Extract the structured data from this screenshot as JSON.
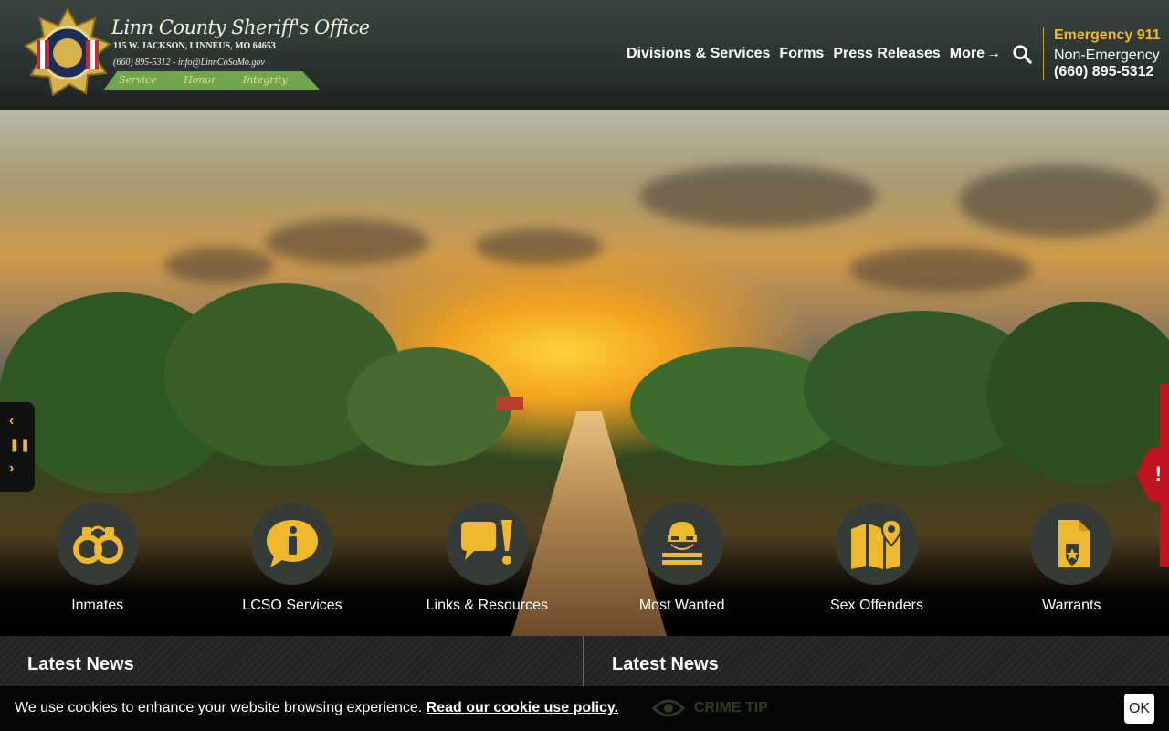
{
  "header": {
    "logo": {
      "title": "Linn County Sheriff's Office",
      "address": "115 W. JACKSON, LINNEUS, MO 64653",
      "contact": "(660) 895-5312 - info@LinnCoSoMo.gov",
      "motto": "Service Honor Integrity",
      "badge_top": "LINN COUNTY",
      "badge_bottom": "SHERIFF'S OFFICE"
    },
    "nav": {
      "items": [
        "Divisions & Services",
        "Forms",
        "Press Releases"
      ],
      "more_label": "More"
    },
    "phones": {
      "emergency": "Emergency 911",
      "non_emergency_label": "Non-Emergency",
      "non_emergency_number": "(660) 895-5312"
    }
  },
  "quick_links": [
    {
      "label": "Inmates",
      "icon": "handcuffs-icon"
    },
    {
      "label": "LCSO Services",
      "icon": "info-icon"
    },
    {
      "label": "Links & Resources",
      "icon": "alert-speech-icon"
    },
    {
      "label": "Most Wanted",
      "icon": "masked-robber-icon"
    },
    {
      "label": "Sex Offenders",
      "icon": "map-marker-icon"
    },
    {
      "label": "Warrants",
      "icon": "badge-document-icon"
    }
  ],
  "news": {
    "left_title": "Latest News",
    "right_title": "Latest News"
  },
  "cookie": {
    "text": "We use cookies to enhance your website browsing experience.",
    "link": "Read our cookie use policy.",
    "ok": "OK"
  },
  "crime_tip": "CRIME TIP",
  "colors": {
    "accent": "#f0b92d",
    "header_bg": "#2b3330",
    "alert": "#c1121f"
  }
}
